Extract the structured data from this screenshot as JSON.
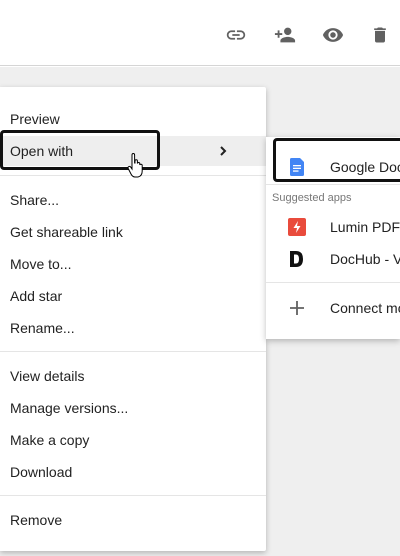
{
  "toolbar": {
    "icons": [
      "link-icon",
      "add-person-icon",
      "eye-icon",
      "trash-icon"
    ]
  },
  "menu": {
    "items": [
      {
        "label": "Preview"
      },
      {
        "label": "Open with"
      },
      {
        "label": "Share..."
      },
      {
        "label": "Get shareable link"
      },
      {
        "label": "Move to..."
      },
      {
        "label": "Add star"
      },
      {
        "label": "Rename..."
      },
      {
        "label": "View details"
      },
      {
        "label": "Manage versions..."
      },
      {
        "label": "Make a copy"
      },
      {
        "label": "Download"
      },
      {
        "label": "Remove"
      }
    ]
  },
  "submenu": {
    "primary_app": "Google Doc",
    "section_label": "Suggested apps",
    "apps": [
      {
        "label": "Lumin PDF"
      },
      {
        "label": "DocHub - V"
      }
    ],
    "connect_label": "Connect mo"
  },
  "colors": {
    "docs_blue": "#4285f4",
    "lumin_red": "#e94b3c",
    "icon_gray": "#616161",
    "menu_highlight": "#eeeeee",
    "background": "#efefef"
  }
}
